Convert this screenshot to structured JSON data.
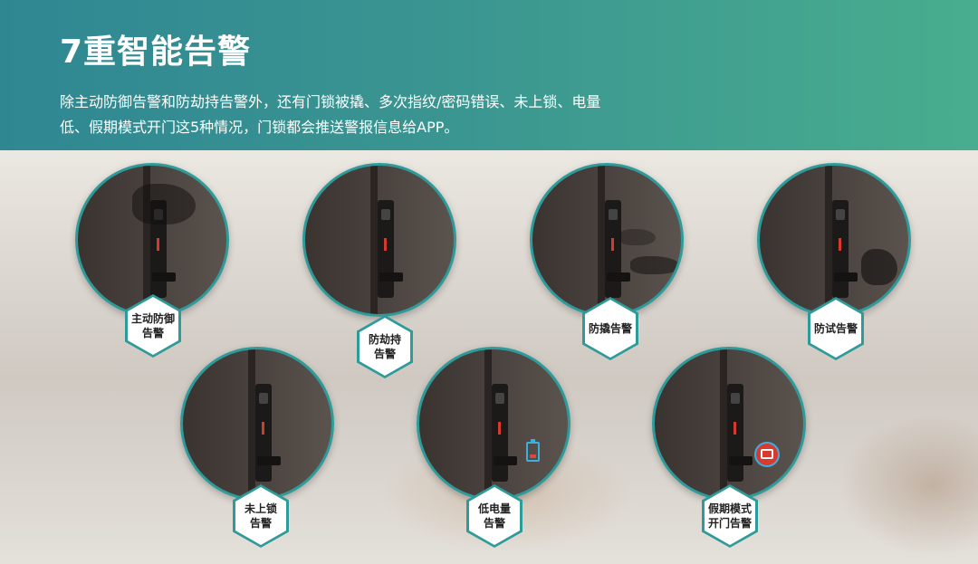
{
  "header": {
    "title": "7重智能告警",
    "description": "除主动防御告警和防劫持告警外，还有门锁被撬、多次指纹/密码错误、未上锁、电量低、假期模式开门这5种情况，门锁都会推送警报信息给APP。"
  },
  "alerts": [
    {
      "line1": "主动防御",
      "line2": "告警"
    },
    {
      "line1": "防劫持",
      "line2": "告警"
    },
    {
      "line1": "防撬告警",
      "line2": ""
    },
    {
      "line1": "防试告警",
      "line2": ""
    },
    {
      "line1": "未上锁",
      "line2": "告警"
    },
    {
      "line1": "低电量",
      "line2": "告警"
    },
    {
      "line1": "假期模式",
      "line2": "开门告警"
    }
  ],
  "colors": {
    "header_start": "#2f8792",
    "header_end": "#48ad8e",
    "accent_teal": "#2e9b9a",
    "lock_indicator": "#d23b2e",
    "battery_outline": "#3bb0e0"
  },
  "icons": {
    "alert_5": "battery-low-icon",
    "alert_6": "holiday-mode-icon"
  }
}
